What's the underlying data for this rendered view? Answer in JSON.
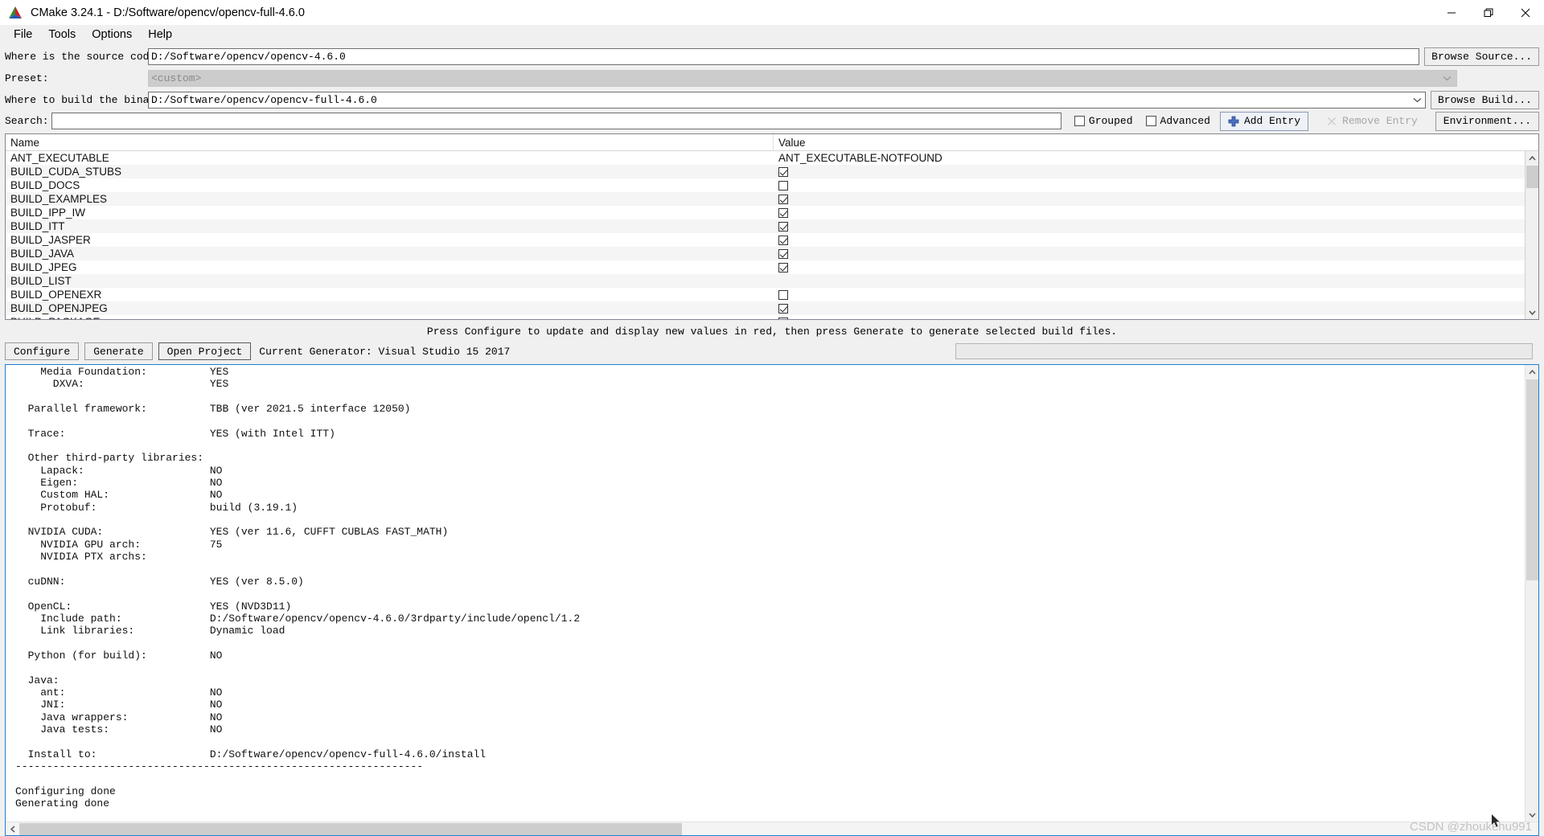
{
  "window": {
    "title": "CMake 3.24.1 - D:/Software/opencv/opencv-full-4.6.0",
    "icon": "cmake-logo-icon",
    "minimize": "minimize-icon",
    "maximize": "maximize-icon",
    "close": "close-icon"
  },
  "menubar": {
    "items": [
      {
        "label": "File"
      },
      {
        "label": "Tools"
      },
      {
        "label": "Options"
      },
      {
        "label": "Help"
      }
    ]
  },
  "paths": {
    "source_label": "Where is the source code:",
    "source_value": "D:/Software/opencv/opencv-4.6.0",
    "browse_source_label": "Browse Source...",
    "preset_label": "Preset:",
    "preset_value": "<custom>",
    "binaries_label": "Where to build the binaries:",
    "binaries_value": "D:/Software/opencv/opencv-full-4.6.0",
    "browse_build_label": "Browse Build..."
  },
  "search": {
    "label": "Search:",
    "value": "",
    "placeholder": "",
    "grouped_label": "Grouped",
    "grouped_checked": false,
    "advanced_label": "Advanced",
    "advanced_checked": false,
    "add_entry_label": "Add Entry",
    "add_entry_icon": "plus-icon",
    "remove_entry_label": "Remove Entry",
    "remove_entry_icon": "remove-icon",
    "remove_entry_disabled": true,
    "environment_label": "Environment..."
  },
  "cache": {
    "columns": [
      "Name",
      "Value"
    ],
    "rows": [
      {
        "name": "ANT_EXECUTABLE",
        "type": "text",
        "value": "ANT_EXECUTABLE-NOTFOUND"
      },
      {
        "name": "BUILD_CUDA_STUBS",
        "type": "checkbox",
        "checked": true,
        "value": ""
      },
      {
        "name": "BUILD_DOCS",
        "type": "checkbox",
        "checked": false,
        "value": ""
      },
      {
        "name": "BUILD_EXAMPLES",
        "type": "checkbox",
        "checked": true,
        "value": ""
      },
      {
        "name": "BUILD_IPP_IW",
        "type": "checkbox",
        "checked": true,
        "value": ""
      },
      {
        "name": "BUILD_ITT",
        "type": "checkbox",
        "checked": true,
        "value": ""
      },
      {
        "name": "BUILD_JASPER",
        "type": "checkbox",
        "checked": true,
        "value": ""
      },
      {
        "name": "BUILD_JAVA",
        "type": "checkbox",
        "checked": true,
        "value": ""
      },
      {
        "name": "BUILD_JPEG",
        "type": "checkbox",
        "checked": true,
        "value": ""
      },
      {
        "name": "BUILD_LIST",
        "type": "text",
        "value": ""
      },
      {
        "name": "BUILD_OPENEXR",
        "type": "checkbox",
        "checked": false,
        "value": ""
      },
      {
        "name": "BUILD_OPENJPEG",
        "type": "checkbox",
        "checked": true,
        "value": ""
      },
      {
        "name": "BUILD_PACKAGE",
        "type": "checkbox",
        "checked": true,
        "value": ""
      }
    ]
  },
  "hint": "Press Configure to update and display new values in red, then press Generate to generate selected build files.",
  "actions": {
    "configure_label": "Configure",
    "generate_label": "Generate",
    "open_project_label": "Open Project",
    "generator_text": "Current Generator: Visual Studio 15 2017",
    "progress_value": 0
  },
  "log": {
    "text": "    Media Foundation:          YES\n      DXVA:                    YES\n\n  Parallel framework:          TBB (ver 2021.5 interface 12050)\n\n  Trace:                       YES (with Intel ITT)\n\n  Other third-party libraries:\n    Lapack:                    NO\n    Eigen:                     NO\n    Custom HAL:                NO\n    Protobuf:                  build (3.19.1)\n\n  NVIDIA CUDA:                 YES (ver 11.6, CUFFT CUBLAS FAST_MATH)\n    NVIDIA GPU arch:           75\n    NVIDIA PTX archs:\n\n  cuDNN:                       YES (ver 8.5.0)\n\n  OpenCL:                      YES (NVD3D11)\n    Include path:              D:/Software/opencv/opencv-4.6.0/3rdparty/include/opencl/1.2\n    Link libraries:            Dynamic load\n\n  Python (for build):          NO\n\n  Java:\n    ant:                       NO\n    JNI:                       NO\n    Java wrappers:             NO\n    Java tests:                NO\n\n  Install to:                  D:/Software/opencv/opencv-full-4.6.0/install\n-----------------------------------------------------------------\n\nConfiguring done\nGenerating done"
  },
  "watermark": "CSDN @zhoukehu991",
  "colors": {
    "accent": "#1e7fd4",
    "window_bg": "#f0f0f0",
    "panel_bg": "#ffffff",
    "alt_row": "#f5f5f5",
    "disabled_text": "#a6a6a6"
  }
}
